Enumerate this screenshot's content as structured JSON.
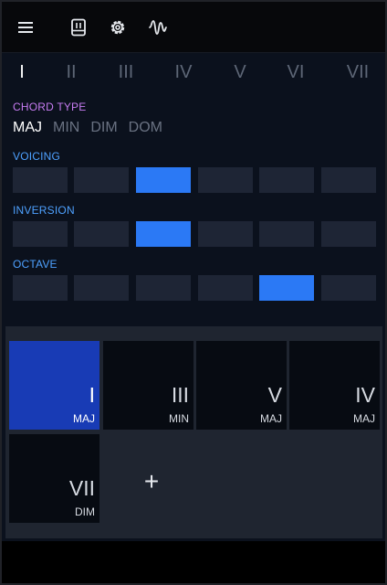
{
  "colors": {
    "accent_blue": "#2b79f5",
    "card_active": "#183bb5",
    "label_purple": "#c77cf2",
    "label_blue": "#4ea1ff",
    "segment_idle": "#1e2535",
    "background": "#0b111d"
  },
  "toolbar": {
    "icons": [
      "menu-icon",
      "notebook-icon",
      "gear-icon",
      "waveform-icon"
    ]
  },
  "degrees": [
    "I",
    "II",
    "III",
    "IV",
    "V",
    "VI",
    "VII"
  ],
  "selected_degree": "I",
  "chord_type": {
    "label": "CHORD TYPE",
    "options": [
      "MAJ",
      "MIN",
      "DIM",
      "DOM"
    ],
    "selected": "MAJ"
  },
  "voicing": {
    "label": "VOICING",
    "segments": 6,
    "selected_index": 2
  },
  "inversion": {
    "label": "INVERSION",
    "segments": 6,
    "selected_index": 2
  },
  "octave": {
    "label": "OCTAVE",
    "segments": 6,
    "selected_index": 4
  },
  "progression": {
    "cards": [
      {
        "roman": "I",
        "type": "MAJ",
        "active": true
      },
      {
        "roman": "III",
        "type": "MIN",
        "active": false
      },
      {
        "roman": "V",
        "type": "MAJ",
        "active": false
      },
      {
        "roman": "IV",
        "type": "MAJ",
        "active": false
      },
      {
        "roman": "VII",
        "type": "DIM",
        "active": false
      }
    ],
    "add_label": "+"
  }
}
